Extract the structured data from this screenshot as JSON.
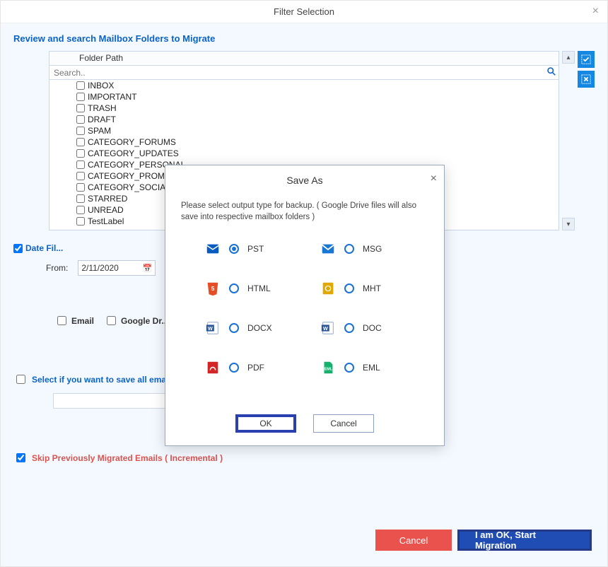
{
  "window": {
    "title": "Filter Selection",
    "close_glyph": "×"
  },
  "section": {
    "heading": "Review and search Mailbox Folders to Migrate"
  },
  "tree": {
    "header": "Folder Path",
    "search_placeholder": "Search..",
    "items": [
      "INBOX",
      "IMPORTANT",
      "TRASH",
      "DRAFT",
      "SPAM",
      "CATEGORY_FORUMS",
      "CATEGORY_UPDATES",
      "CATEGORY_PERSONAL",
      "CATEGORY_PROMOTIONS",
      "CATEGORY_SOCIAL",
      "STARRED",
      "UNREAD",
      "TestLabel"
    ]
  },
  "date_filter": {
    "label": "Date Fil...",
    "checked": true,
    "from_label": "From:",
    "from_value": "2/11/2020"
  },
  "services": {
    "email_label": "Email",
    "gdrive_label": "Google Dr..."
  },
  "saveall": {
    "label": "Select if you want to save all emails in single folder"
  },
  "skip": {
    "label": "Skip Previously Migrated Emails ( Incremental )",
    "checked": true
  },
  "bottom": {
    "cancel": "Cancel",
    "start": "I am OK, Start Migration"
  },
  "modal": {
    "title": "Save As",
    "close_glyph": "×",
    "desc": "Please select output type for backup. ( Google Drive files will also save into respective mailbox folders )",
    "formats": [
      {
        "key": "pst",
        "label": "PST",
        "selected": true,
        "color": "#0a5bbf"
      },
      {
        "key": "msg",
        "label": "MSG",
        "selected": false,
        "color": "#1976d2"
      },
      {
        "key": "html",
        "label": "HTML",
        "selected": false,
        "color": "#e44d26"
      },
      {
        "key": "mht",
        "label": "MHT",
        "selected": false,
        "color": "#e0a800"
      },
      {
        "key": "docx",
        "label": "DOCX",
        "selected": false,
        "color": "#2b579a"
      },
      {
        "key": "doc",
        "label": "DOC",
        "selected": false,
        "color": "#2b579a"
      },
      {
        "key": "pdf",
        "label": "PDF",
        "selected": false,
        "color": "#d32525"
      },
      {
        "key": "eml",
        "label": "EML",
        "selected": false,
        "color": "#15b26e"
      }
    ],
    "ok": "OK",
    "cancel": "Cancel"
  }
}
